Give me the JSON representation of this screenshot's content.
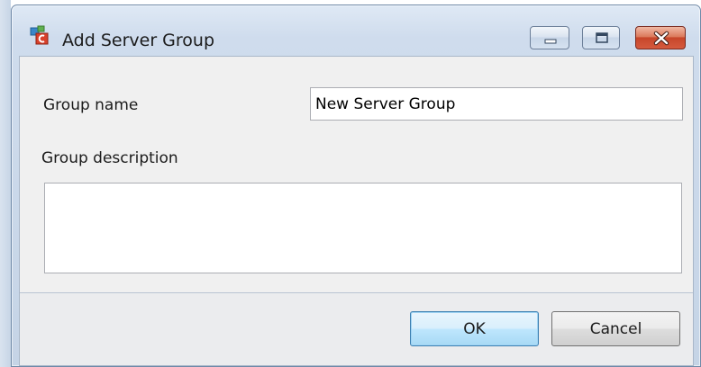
{
  "window": {
    "title": "Add Server Group"
  },
  "form": {
    "group_name_label": "Group name",
    "group_name_value": "New Server Group",
    "group_description_label": "Group description",
    "group_description_value": ""
  },
  "buttons": {
    "ok_label": "OK",
    "cancel_label": "Cancel"
  },
  "icons": {
    "app": "server-group-icon",
    "minimize": "minimize-icon",
    "maximize": "maximize-icon",
    "close": "close-icon"
  },
  "colors": {
    "title_bar": "#cfdced",
    "close_button": "#c7462a",
    "ok_button_border": "#3c7fb1"
  }
}
